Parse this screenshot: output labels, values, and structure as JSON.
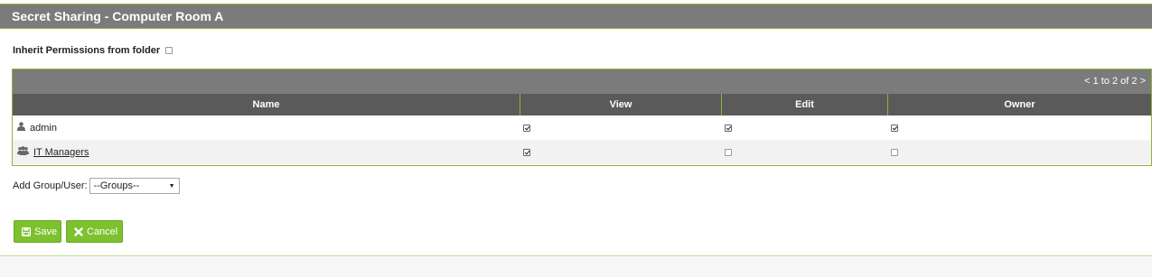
{
  "header": {
    "title": "Secret Sharing - Computer Room A"
  },
  "inherit": {
    "label": "Inherit Permissions from folder",
    "checked": false
  },
  "grid": {
    "pager": "< 1 to 2 of 2 >",
    "columns": [
      "Name",
      "View",
      "Edit",
      "Owner"
    ],
    "rows": [
      {
        "icon": "user-icon",
        "name": "admin",
        "link": false,
        "view": true,
        "edit": true,
        "owner": true
      },
      {
        "icon": "group-icon",
        "name": "IT Managers",
        "link": true,
        "view": true,
        "edit": false,
        "owner": false
      }
    ]
  },
  "add": {
    "label": "Add Group/User:",
    "selected": "--Groups--"
  },
  "buttons": {
    "save_label": "Save",
    "cancel_label": "Cancel"
  },
  "colors": {
    "accent": "#8cb63c",
    "button": "#7dc12e",
    "header_bg": "#7b7b7b",
    "column_header_bg": "#5a5a5a"
  }
}
